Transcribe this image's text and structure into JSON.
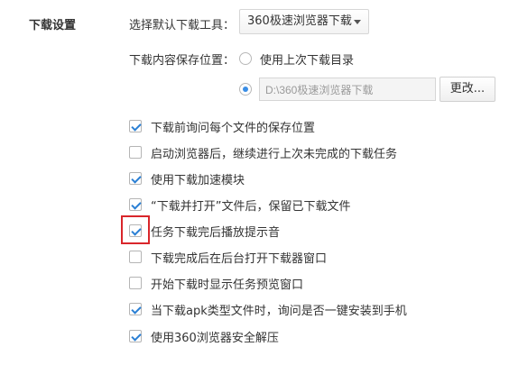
{
  "section_title": "下载设置",
  "tool": {
    "label": "选择默认下载工具：",
    "selected": "360极速浏览器下载"
  },
  "save_location": {
    "label": "下载内容保存位置：",
    "option_last_dir": "使用上次下载目录",
    "option_last_dir_selected": false,
    "option_custom_selected": true,
    "path_value": "D:\\360极速浏览器下载",
    "change_button": "更改..."
  },
  "options": [
    {
      "label": "下载前询问每个文件的保存位置",
      "checked": true
    },
    {
      "label": "启动浏览器后，继续进行上次未完成的下载任务",
      "checked": false
    },
    {
      "label": "使用下载加速模块",
      "checked": true
    },
    {
      "label": "“下载并打开”文件后，保留已下载文件",
      "checked": true
    },
    {
      "label": "任务下载完后播放提示音",
      "checked": true,
      "highlighted": true
    },
    {
      "label": "下载完成后在后台打开下载器窗口",
      "checked": false
    },
    {
      "label": "开始下载时显示任务预览窗口",
      "checked": false
    },
    {
      "label": "当下载apk类型文件时，询问是否一键安装到手机",
      "checked": true
    },
    {
      "label": "使用360浏览器安全解压",
      "checked": true
    }
  ],
  "colors": {
    "check_accent": "#2a7fd4",
    "highlight_border": "#d9262b"
  }
}
